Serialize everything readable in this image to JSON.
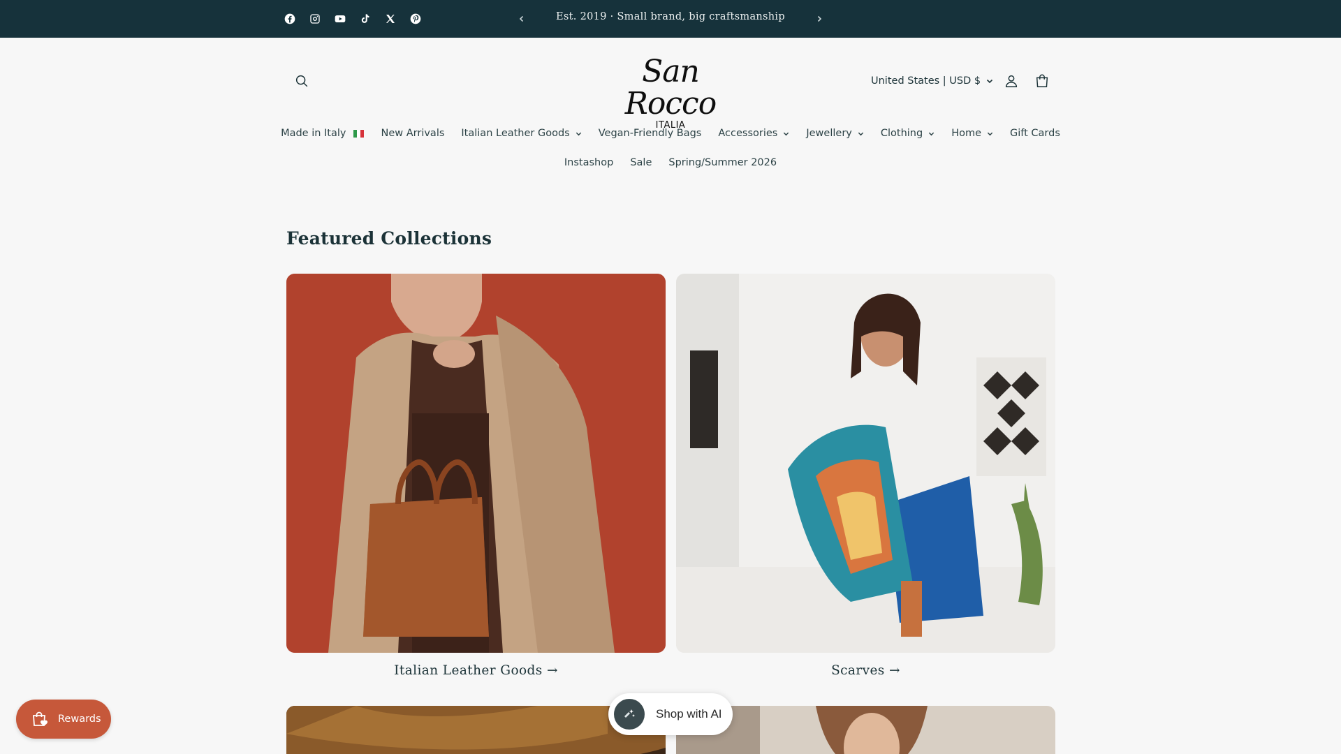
{
  "announcement": {
    "text": "Est. 2019 · Small brand, big craftsmanship",
    "socials": [
      "facebook-icon",
      "instagram-icon",
      "youtube-icon",
      "tiktok-icon",
      "x-icon",
      "pinterest-icon"
    ]
  },
  "header": {
    "logo_script": "San Rocco",
    "logo_sub": "ITALIA",
    "currency": "United States | USD $"
  },
  "nav": {
    "row1": [
      {
        "label": "Made in Italy",
        "has_dropdown": false
      },
      {
        "label": "New Arrivals",
        "has_dropdown": false
      },
      {
        "label": "Italian Leather Goods",
        "has_dropdown": true
      },
      {
        "label": "Vegan-Friendly Bags",
        "has_dropdown": false
      },
      {
        "label": "Accessories",
        "has_dropdown": true
      },
      {
        "label": "Jewellery",
        "has_dropdown": true
      },
      {
        "label": "Clothing",
        "has_dropdown": true
      },
      {
        "label": "Home",
        "has_dropdown": true
      },
      {
        "label": "Gift Cards",
        "has_dropdown": false
      }
    ],
    "row2": [
      {
        "label": "Instashop"
      },
      {
        "label": "Sale"
      },
      {
        "label": "Spring/Summer 2026"
      }
    ]
  },
  "featured": {
    "title": "Featured Collections",
    "collections": [
      {
        "label": "Italian Leather Goods →"
      },
      {
        "label": "Scarves →"
      }
    ]
  },
  "floating": {
    "rewards_label": "Rewards",
    "shop_ai_label": "Shop with AI"
  },
  "colors": {
    "announcement_bg": "#16323b",
    "rewards_bg": "#c6583a",
    "page_bg": "#f7f7f7",
    "text": "#1b3237"
  }
}
